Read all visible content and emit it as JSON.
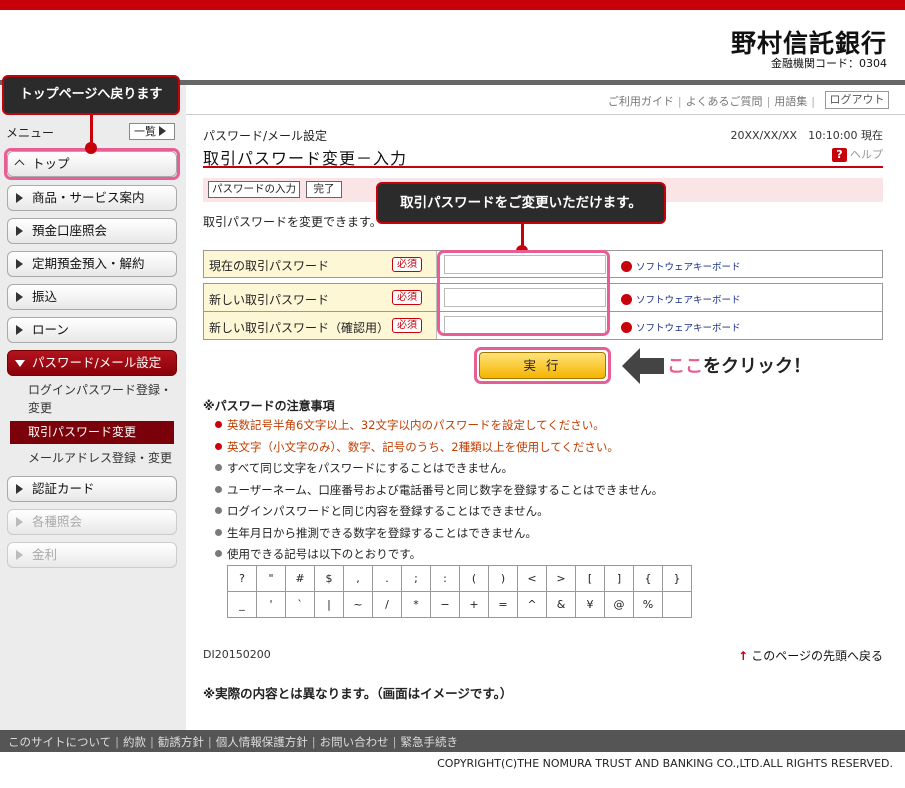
{
  "header": {
    "bank_name": "野村信託銀行",
    "bank_code": "金融機関コード：0304"
  },
  "util_nav": {
    "links": [
      "ご利用ガイド",
      "よくあるご質問",
      "用語集"
    ],
    "logout": "ログアウト"
  },
  "sidebar": {
    "menu_label": "メニュー",
    "list_button": "一覧",
    "items": [
      {
        "label": "トップ"
      },
      {
        "label": "商品・サービス案内"
      },
      {
        "label": "預金口座照会"
      },
      {
        "label": "定期預金預入・解約"
      },
      {
        "label": "振込"
      },
      {
        "label": "ローン"
      },
      {
        "label": "パスワード/メール設定"
      },
      {
        "label": "認証カード"
      },
      {
        "label": "各種照会"
      },
      {
        "label": "金利"
      }
    ],
    "submenu": [
      {
        "label": "ログインパスワード登録・"
      },
      {
        "label": "変更"
      },
      {
        "label": "取引パスワード変更"
      },
      {
        "label": "メールアドレス登録・変更"
      }
    ]
  },
  "callouts": {
    "top": "トップページへ戻ります",
    "mid": "取引パスワードをご変更いただけます。",
    "click_pink": "ここ",
    "click_rest": "をクリック！"
  },
  "main": {
    "breadcrumb": "パスワード/メール設定",
    "datetime": "20XX/XX/XX　10:10:00 現在",
    "title": "取引パスワード変更－入力",
    "help": "ヘルプ",
    "steps": [
      "パスワードの入力",
      "完了"
    ],
    "intro": "取引パスワードを変更できます。",
    "fields": [
      {
        "label": "現在の取引パスワード",
        "required": "必須",
        "keyboard": "ソフトウェアキーボード"
      },
      {
        "label": "新しい取引パスワード",
        "required": "必須",
        "keyboard": "ソフトウェアキーボード"
      },
      {
        "label": "新しい取引パスワード（確認用）",
        "required": "必須",
        "keyboard": "ソフトウェアキーボード"
      }
    ],
    "execute": "実 行",
    "notes_title": "※パスワードの注意事項",
    "notes": [
      "英数記号半角6文字以上、32文字以内のパスワードを設定してください。",
      "英文字（小文字のみ）、数字、記号のうち、2種類以上を使用してください。",
      "すべて同じ文字をパスワードにすることはできません。",
      "ユーザーネーム、口座番号および電話番号と同じ数字を登録することはできません。",
      "ログインパスワードと同じ内容を登録することはできません。",
      "生年月日から推測できる数字を登録することはできません。",
      "使用できる記号は以下のとおりです。"
    ],
    "symbols_row1": [
      "?",
      "\"",
      "#",
      "$",
      ",",
      ".",
      ";",
      ":",
      "(",
      ")",
      "<",
      ">",
      "[",
      "]",
      "{",
      "}"
    ],
    "symbols_row2": [
      "_",
      "'",
      "`",
      "|",
      "~",
      "/",
      "*",
      "−",
      "+",
      "=",
      "^",
      "&",
      "¥",
      "@",
      "%",
      ""
    ],
    "doc_id": "DI20150200",
    "page_top": "このページの先頭へ戻る",
    "disclaimer": "※実際の内容とは異なります。（画面はイメージです。）"
  },
  "footer": {
    "links": [
      "このサイトについて",
      "約款",
      "勧誘方針",
      "個人情報保護方針",
      "お問い合わせ",
      "緊急手続き"
    ],
    "copyright": "COPYRIGHT(C)THE NOMURA TRUST AND BANKING CO.,LTD.ALL RIGHTS RESERVED."
  },
  "colors": {
    "brand_red": "#c8000a",
    "highlight_pink": "#e85d94",
    "button_yellow": "#f5b400"
  }
}
